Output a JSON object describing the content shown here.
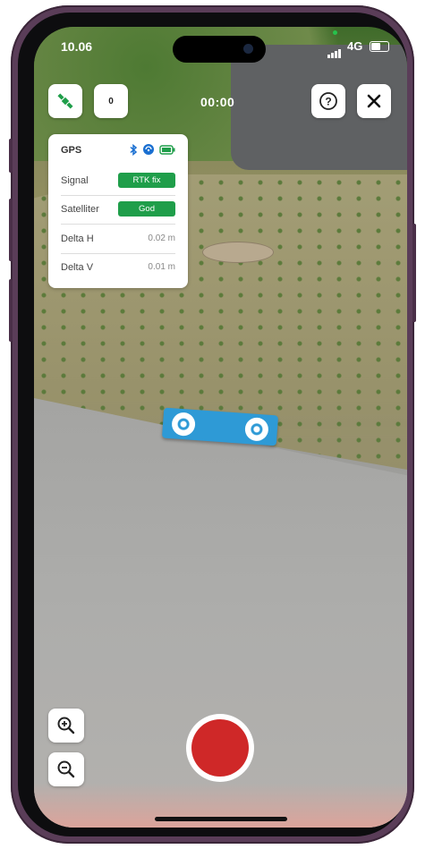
{
  "status_bar": {
    "time": "10.06",
    "network": "4G"
  },
  "top_bar": {
    "counter": "0",
    "timer": "00:00",
    "help_icon": "question-circle-icon",
    "close_icon": "close-icon",
    "gps_button_icon": "satellite-icon"
  },
  "gps_panel": {
    "title": "GPS",
    "icons": [
      "bluetooth-icon",
      "signal-globe-icon",
      "battery-icon"
    ],
    "rows": [
      {
        "label": "Signal",
        "value": "RTK fix",
        "style": "badge"
      },
      {
        "label": "Satelliter",
        "value": "God",
        "style": "badge"
      },
      {
        "label": "Delta H",
        "value": "0.02 m",
        "style": "text"
      },
      {
        "label": "Delta V",
        "value": "0.01 m",
        "style": "text"
      }
    ]
  },
  "controls": {
    "zoom_in_icon": "zoom-in-icon",
    "zoom_out_icon": "zoom-out-icon",
    "record_icon": "record-button"
  },
  "colors": {
    "accent_green": "#1f9e4a",
    "record_red": "#cf2828",
    "frame": "#5a3d58",
    "marker_blue": "#2e9ad6"
  }
}
